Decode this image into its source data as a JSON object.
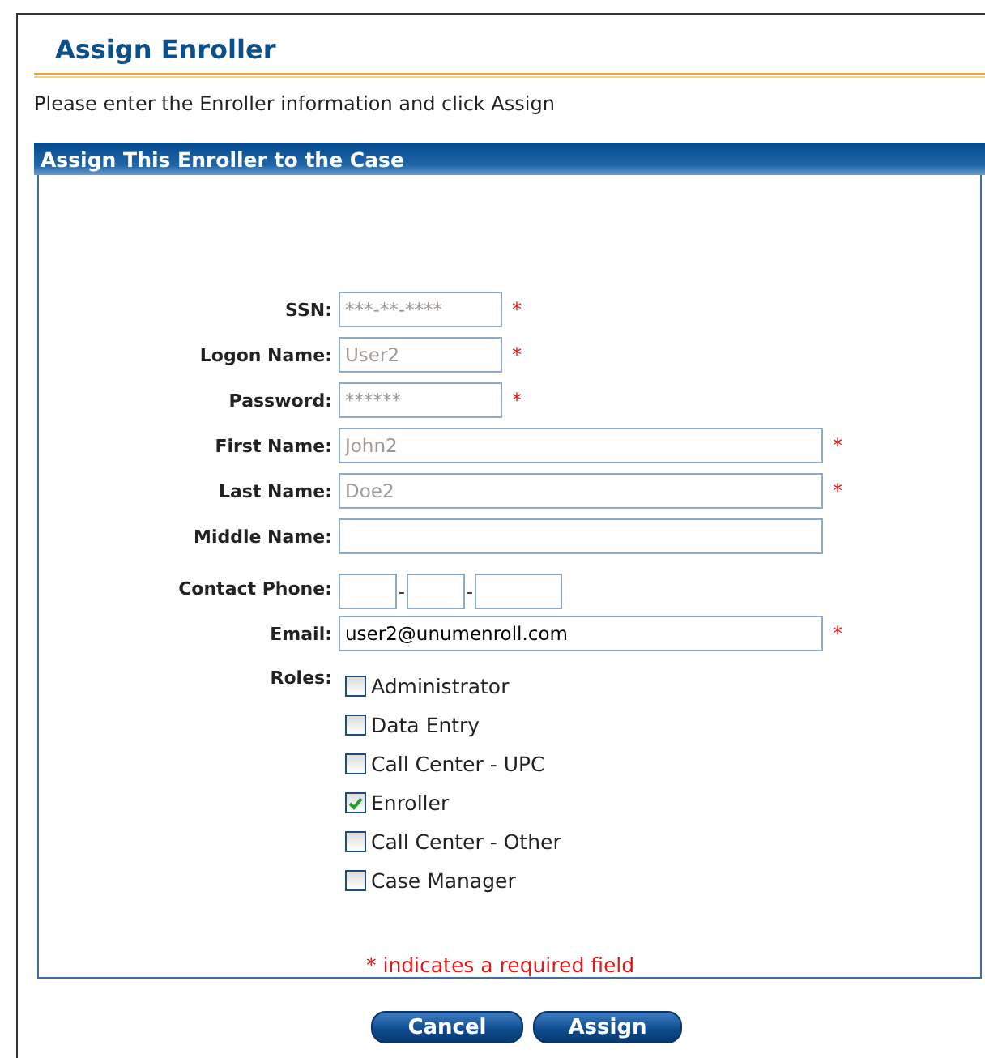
{
  "title": "Assign Enroller",
  "instructions": "Please enter the Enroller information and click Assign",
  "panel": {
    "title": "Assign This Enroller to the Case"
  },
  "required_mark": "*",
  "fields": [
    {
      "label": "SSN:",
      "kind": "short",
      "value": "***-**-****",
      "disabled": true,
      "required": true
    },
    {
      "label": "Logon Name:",
      "kind": "short",
      "value": "User2",
      "disabled": true,
      "required": true
    },
    {
      "label": "Password:",
      "kind": "short",
      "value": "******",
      "disabled": true,
      "required": true
    },
    {
      "label": "First Name:",
      "kind": "long",
      "value": "John2",
      "disabled": true,
      "required": true
    },
    {
      "label": "Last Name:",
      "kind": "long",
      "value": "Doe2",
      "disabled": true,
      "required": true
    },
    {
      "label": "Middle Name:",
      "kind": "long",
      "required": false
    },
    {
      "label": "Contact Phone:",
      "kind": "phone",
      "separators": [
        "-",
        "-"
      ],
      "required": false
    },
    {
      "label": "Email:",
      "kind": "long",
      "value": "user2@unumenroll.com",
      "disabled": false,
      "required": true
    }
  ],
  "roles": {
    "label": "Roles:",
    "options": [
      {
        "label": "Administrator",
        "checked": false
      },
      {
        "label": "Data Entry",
        "checked": false
      },
      {
        "label": "Call Center - UPC",
        "checked": false
      },
      {
        "label": "Enroller",
        "checked": true
      },
      {
        "label": "Call Center - Other",
        "checked": false
      },
      {
        "label": "Case Manager",
        "checked": false
      }
    ]
  },
  "required_note": "* indicates a required field",
  "buttons": [
    {
      "label": "Cancel"
    },
    {
      "label": "Assign"
    }
  ]
}
